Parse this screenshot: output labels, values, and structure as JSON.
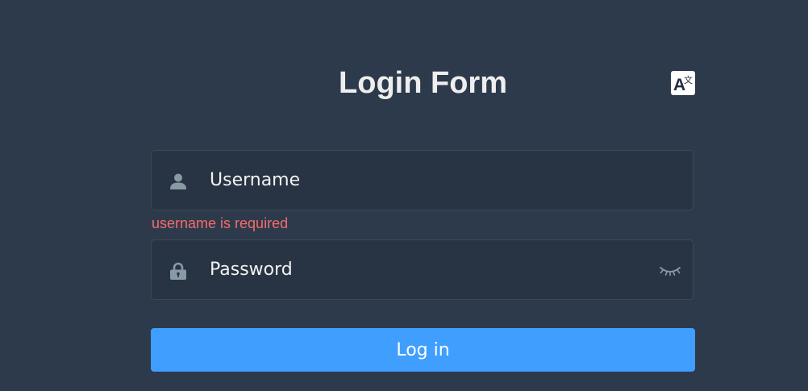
{
  "form": {
    "title": "Login Form",
    "language_icon": "translate-icon",
    "username": {
      "icon": "user-icon",
      "placeholder": "Username",
      "value": "",
      "error": "username is required"
    },
    "password": {
      "icon": "lock-icon",
      "placeholder": "Password",
      "value": "",
      "toggle_icon": "eye-closed-icon"
    },
    "login_label": "Log in"
  },
  "colors": {
    "background": "#2d3a4b",
    "input_background": "#283443",
    "title": "#eeeeee",
    "icon": "#889aa4",
    "error": "#f56c6c",
    "primary": "#409eff"
  }
}
